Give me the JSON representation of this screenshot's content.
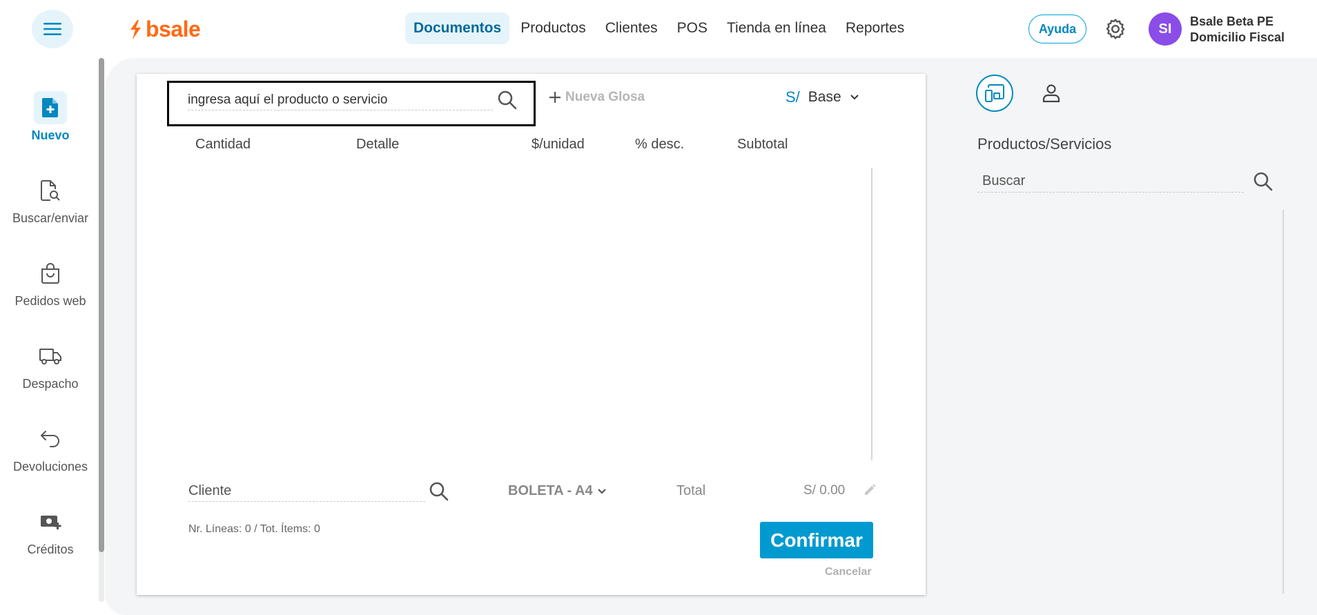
{
  "header": {
    "logo_text": "bsale",
    "nav": [
      "Documentos",
      "Productos",
      "Clientes",
      "POS",
      "Tienda en línea",
      "Reportes"
    ],
    "active_nav": "Documentos",
    "help_label": "Ayuda",
    "avatar_initials": "SI",
    "user_name": "Bsale Beta PE",
    "user_branch": "Domicilio Fiscal",
    "icons": {
      "menu": "hamburger-icon",
      "settings": "gear-icon"
    }
  },
  "sidebar": {
    "items": [
      {
        "label": "Nuevo",
        "icon": "new-document-icon",
        "active": true
      },
      {
        "label": "Buscar/enviar",
        "icon": "document-search-icon",
        "active": false
      },
      {
        "label": "Pedidos web",
        "icon": "shopping-bag-icon",
        "active": false
      },
      {
        "label": "Despacho",
        "icon": "truck-icon",
        "active": false
      },
      {
        "label": "Devoluciones",
        "icon": "return-arrow-icon",
        "active": false
      },
      {
        "label": "Créditos",
        "icon": "credit-cash-icon",
        "active": false
      }
    ]
  },
  "document": {
    "product_search_placeholder": "ingresa aquí el producto o servicio",
    "new_glosa_label": "Nueva Glosa",
    "currency_symbol": "S/",
    "price_list": "Base",
    "columns": [
      "Cantidad",
      "Detalle",
      "$/unidad",
      "% desc.",
      "Subtotal"
    ],
    "client_placeholder": "Cliente",
    "doc_type": "BOLETA - A4",
    "total_label": "Total",
    "total_value": "S/ 0.00",
    "lines_info": "Nr. Líneas: 0 / Tot. Ítems: 0",
    "confirm_label": "Confirmar",
    "cancel_label": "Cancelar"
  },
  "right_panel": {
    "title": "Productos/Servicios",
    "search_placeholder": "Buscar",
    "tabs": [
      "products-grid-icon",
      "user-icon"
    ]
  },
  "colors": {
    "brand_orange": "#ff6a13",
    "accent_blue": "#0088bf",
    "confirm_blue": "#009ad0",
    "avatar_purple": "#8a4de8",
    "active_bg": "#e5f4fa"
  }
}
